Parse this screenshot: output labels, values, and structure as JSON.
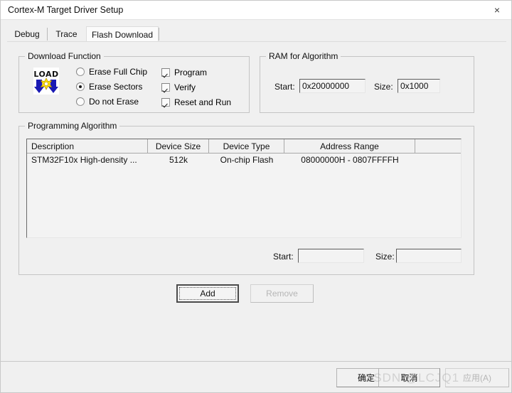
{
  "window": {
    "title": "Cortex-M Target Driver Setup",
    "close_icon": "close-icon",
    "close_glyph": "×"
  },
  "tabs": [
    {
      "label": "Debug",
      "active": false
    },
    {
      "label": "Trace",
      "active": false
    },
    {
      "label": "Flash Download",
      "active": true
    }
  ],
  "download_function": {
    "legend": "Download Function",
    "icon_label": "LOAD",
    "radios": [
      {
        "label": "Erase Full Chip",
        "checked": false
      },
      {
        "label": "Erase Sectors",
        "checked": true
      },
      {
        "label": "Do not Erase",
        "checked": false
      }
    ],
    "checkboxes": [
      {
        "label": "Program",
        "checked": true
      },
      {
        "label": "Verify",
        "checked": true
      },
      {
        "label": "Reset and Run",
        "checked": true
      }
    ]
  },
  "ram_for_algorithm": {
    "legend": "RAM for Algorithm",
    "start_label": "Start:",
    "start_value": "0x20000000",
    "size_label": "Size:",
    "size_value": "0x1000"
  },
  "programming_algorithm": {
    "legend": "Programming Algorithm",
    "columns": [
      "Description",
      "Device Size",
      "Device Type",
      "Address Range",
      ""
    ],
    "rows": [
      {
        "description": "STM32F10x High-density ...",
        "device_size": "512k",
        "device_type": "On-chip Flash",
        "address_range": "08000000H - 0807FFFFH",
        "extra": ""
      }
    ],
    "start_label": "Start:",
    "start_value": "",
    "size_label": "Size:",
    "size_value": "",
    "add_label": "Add",
    "remove_label": "Remove"
  },
  "bottom_bar": {
    "ok_label": "确定",
    "cancel_label": "取消",
    "apply_label": "应用(A)"
  },
  "watermark": {
    "text": "CSDN @LCJQ1"
  },
  "colors": {
    "dialog_background": "#f0f0f0",
    "field_background": "#f3f3f3",
    "accent_icon_blue": "#1a1ab4",
    "accent_icon_yellow": "#ffe000",
    "text": "#101010",
    "disabled_text": "#b6b6b6"
  }
}
